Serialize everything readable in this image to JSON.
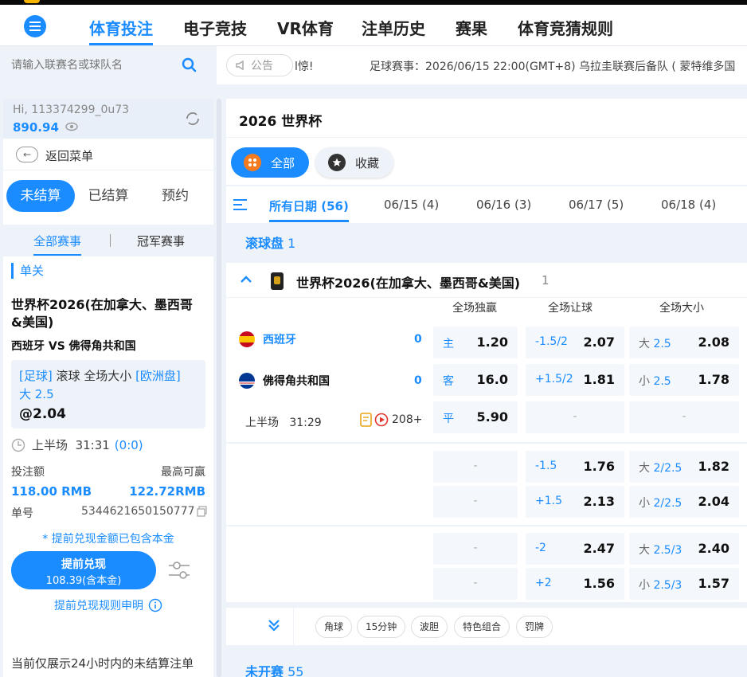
{
  "nav": {
    "tabs": [
      "体育投注",
      "电子竞技",
      "VR体育",
      "注单历史",
      "赛果",
      "体育竞猜规则"
    ],
    "active_index": 0
  },
  "search": {
    "placeholder": "请输入联赛名或球队名"
  },
  "notice": {
    "label": "公告",
    "tail": "l惊!",
    "message": "足球赛事：2026/06/15 22:00(GMT+8) 乌拉圭联赛后备队 ( 蒙特维多国"
  },
  "user": {
    "name": "Hi, 113374299_0u73",
    "balance": "890.94"
  },
  "sidebar": {
    "back_label": "返回菜单",
    "status_tabs": [
      "未结算",
      "已结算",
      "预约"
    ],
    "sub_tabs": [
      "全部赛事",
      "冠军赛事"
    ],
    "section": "单关",
    "bet": {
      "league": "世界杯2026(在加拿大、墨西哥&美国)",
      "match": "西班牙 VS 佛得角共和国",
      "sport": "[足球]",
      "market": "滚球 全场大小",
      "odds_type": "[欧洲盘]",
      "selection": "大 2.5",
      "odds": "@2.04",
      "period": "上半场",
      "time": "31:31",
      "score": "(0:0)",
      "stake_label": "投注额",
      "max_win_label": "最高可赢",
      "stake": "118.00 RMB",
      "max_win": "122.72RMB",
      "order_label": "单号",
      "order_no": "5344621650150777",
      "note": "* 提前兑现金额已包含本金",
      "cashout_label": "提前兑现",
      "cashout_amount": "108.39(含本金)",
      "rules_label": "提前兑现规则申明"
    },
    "footnote": "当前仅展示24小时内的未结算注单"
  },
  "main": {
    "title": "2026 世界杯",
    "filters": [
      "全部",
      "收藏"
    ],
    "date_tabs": [
      "所有日期 (56)",
      "06/15 (4)",
      "06/16 (3)",
      "06/17 (5)",
      "06/18 (4)"
    ],
    "live_label": "滚球盘",
    "live_count": "1",
    "league_name": "世界杯2026(在加拿大、墨西哥&美国)",
    "league_count": "1",
    "columns": [
      "全场独赢",
      "全场让球",
      "全场大小"
    ],
    "home_team": "西班牙",
    "away_team": "佛得角共和国",
    "home_score": "0",
    "away_score": "0",
    "period": "上半场",
    "clock": "31:29",
    "more_count": "208+",
    "moneyline": [
      {
        "k": "主",
        "v": "1.20"
      },
      {
        "k": "客",
        "v": "16.0"
      },
      {
        "k": "平",
        "v": "5.90"
      }
    ],
    "handicap_rows": [
      [
        {
          "k": "-1.5/2",
          "v": "2.07"
        },
        {
          "k": "+1.5/2",
          "v": "1.81"
        }
      ],
      [
        {
          "k": "-1.5",
          "v": "1.76"
        },
        {
          "k": "+1.5",
          "v": "2.13"
        }
      ],
      [
        {
          "k": "-2",
          "v": "2.47"
        },
        {
          "k": "+2",
          "v": "1.56"
        }
      ]
    ],
    "total_rows": [
      [
        {
          "k": "大",
          "l": "2.5",
          "v": "2.08"
        },
        {
          "k": "小",
          "l": "2.5",
          "v": "1.78"
        }
      ],
      [
        {
          "k": "大",
          "l": "2/2.5",
          "v": "1.82"
        },
        {
          "k": "小",
          "l": "2/2.5",
          "v": "2.04"
        }
      ],
      [
        {
          "k": "大",
          "l": "2.5/3",
          "v": "2.40"
        },
        {
          "k": "小",
          "l": "2.5/3",
          "v": "1.57"
        }
      ]
    ],
    "dash": "-",
    "chips": [
      "角球",
      "15分钟",
      "波胆",
      "特色组合",
      "罚牌"
    ],
    "upcoming_label": "未开赛",
    "upcoming_count": "55"
  },
  "colors": {
    "accent": "#1a8cff",
    "background": "#eef2f9"
  }
}
